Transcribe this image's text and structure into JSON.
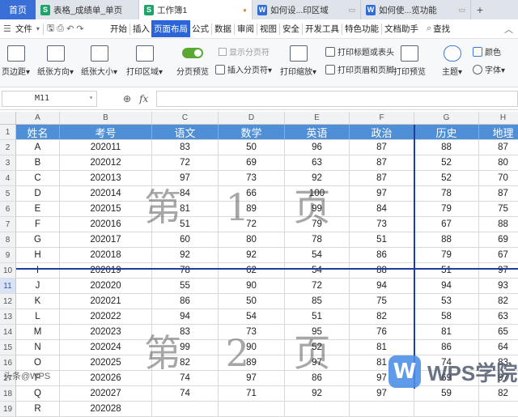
{
  "tabs": {
    "home": "首页",
    "docs": [
      {
        "icon": "S",
        "kind": "s",
        "label": "表格_成绩单_单页",
        "active": false
      },
      {
        "icon": "S",
        "kind": "s",
        "label": "工作簿1",
        "active": true
      },
      {
        "icon": "W",
        "kind": "w",
        "label": "如何设...印区域",
        "active": false
      },
      {
        "icon": "W",
        "kind": "w",
        "label": "如何使...览功能",
        "active": false
      }
    ],
    "add": "+"
  },
  "menu": {
    "file": "文件",
    "items": [
      "开始",
      "插入",
      "页面布局",
      "公式",
      "数据",
      "审阅",
      "视图",
      "安全",
      "开发工具",
      "特色功能",
      "文档助手"
    ],
    "active": "页面布局",
    "search": "查找"
  },
  "ribbon": {
    "margins": "页边距",
    "orientation": "纸张方向",
    "size": "纸张大小",
    "print_area": "打印区域",
    "page_preview": "分页预览",
    "show_breaks": "显示分页符",
    "insert_break": "插入分页符",
    "print_scale": "打印缩放",
    "print_titles": "打印标题或表头",
    "print_header_footer": "打印页眉和页脚",
    "print_preview": "打印预览",
    "theme": "主题",
    "colors": "颜色",
    "fonts": "字体"
  },
  "formula_bar": {
    "cell_ref": "M11",
    "fx": "fx",
    "value": ""
  },
  "columns": [
    "A",
    "B",
    "C",
    "D",
    "E",
    "F",
    "G",
    "H"
  ],
  "headers": [
    "姓名",
    "考号",
    "语文",
    "数学",
    "英语",
    "政治",
    "历史",
    "地理"
  ],
  "rows": [
    [
      "A",
      "202011",
      "83",
      "50",
      "96",
      "87",
      "88",
      "87"
    ],
    [
      "B",
      "202012",
      "72",
      "69",
      "63",
      "87",
      "52",
      "80"
    ],
    [
      "C",
      "202013",
      "97",
      "73",
      "92",
      "87",
      "52",
      "70"
    ],
    [
      "D",
      "202014",
      "84",
      "66",
      "100",
      "97",
      "78",
      "87"
    ],
    [
      "E",
      "202015",
      "81",
      "89",
      "99",
      "84",
      "79",
      "75"
    ],
    [
      "F",
      "202016",
      "51",
      "72",
      "79",
      "73",
      "67",
      "88"
    ],
    [
      "G",
      "202017",
      "60",
      "80",
      "78",
      "51",
      "88",
      "69"
    ],
    [
      "H",
      "202018",
      "92",
      "92",
      "54",
      "86",
      "79",
      "67"
    ],
    [
      "I",
      "202019",
      "78",
      "62",
      "54",
      "88",
      "51",
      "97"
    ],
    [
      "J",
      "202020",
      "55",
      "90",
      "72",
      "94",
      "94",
      "93"
    ],
    [
      "K",
      "202021",
      "86",
      "50",
      "85",
      "75",
      "53",
      "82"
    ],
    [
      "L",
      "202022",
      "94",
      "54",
      "51",
      "82",
      "58",
      "63"
    ],
    [
      "M",
      "202023",
      "83",
      "73",
      "95",
      "76",
      "81",
      "65"
    ],
    [
      "N",
      "202024",
      "99",
      "90",
      "52",
      "81",
      "86",
      "64"
    ],
    [
      "O",
      "202025",
      "82",
      "89",
      "97",
      "81",
      "74",
      "83"
    ],
    [
      "P",
      "202026",
      "74",
      "97",
      "86",
      "97",
      "69",
      "97"
    ],
    [
      "Q",
      "202027",
      "74",
      "71",
      "92",
      "97",
      "59",
      "82"
    ],
    [
      "R",
      "202028",
      "",
      "",
      "",
      "",
      "",
      ""
    ]
  ],
  "row_numbers": [
    "1",
    "2",
    "3",
    "4",
    "5",
    "6",
    "7",
    "8",
    "9",
    "10",
    "11",
    "12",
    "13",
    "14",
    "15",
    "16",
    "17",
    "18",
    "19"
  ],
  "watermarks": {
    "page1": "第 1 页",
    "page2": "第 2 页"
  },
  "logo": {
    "mark": "W",
    "text": "WPS学院"
  },
  "user_watermark": "头条@WPS"
}
